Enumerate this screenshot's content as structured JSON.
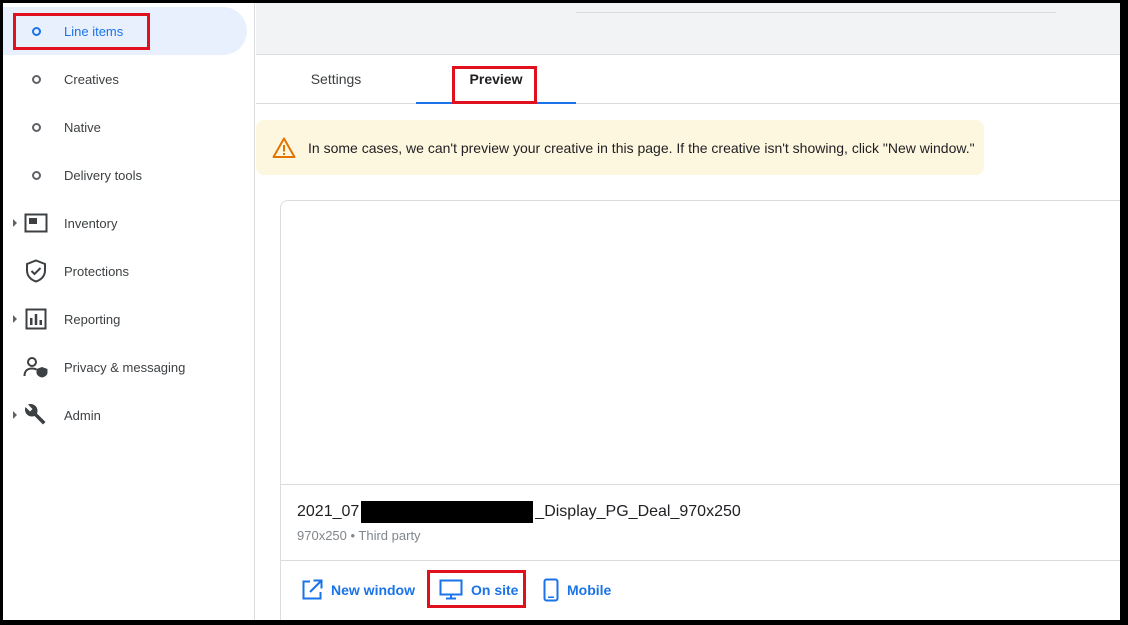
{
  "sidebar": {
    "items": [
      {
        "label": "Line items",
        "icon": "circle-icon",
        "active": true
      },
      {
        "label": "Creatives",
        "icon": "circle-icon"
      },
      {
        "label": "Native",
        "icon": "circle-icon"
      },
      {
        "label": "Delivery tools",
        "icon": "circle-icon"
      },
      {
        "label": "Inventory",
        "icon": "inventory-icon",
        "expandable": true
      },
      {
        "label": "Protections",
        "icon": "shield-icon"
      },
      {
        "label": "Reporting",
        "icon": "reporting-icon",
        "expandable": true
      },
      {
        "label": "Privacy & messaging",
        "icon": "person-shield-icon"
      },
      {
        "label": "Admin",
        "icon": "wrench-icon",
        "expandable": true
      }
    ]
  },
  "tabs": {
    "settings": "Settings",
    "preview": "Preview"
  },
  "warning": {
    "text": "In some cases, we can't preview your creative in this page. If the creative isn't showing, click \"New window.\""
  },
  "creative": {
    "name_prefix": "2021_07",
    "name_suffix": "_Display_PG_Deal_970x250",
    "meta": "970x250 • Third party"
  },
  "actions": {
    "new_window": "New window",
    "on_site": "On site",
    "mobile": "Mobile"
  },
  "colors": {
    "accent": "#1a73e8",
    "highlight": "#e0101e",
    "warning_bg": "#fef7e0",
    "warning_icon": "#e37400"
  }
}
